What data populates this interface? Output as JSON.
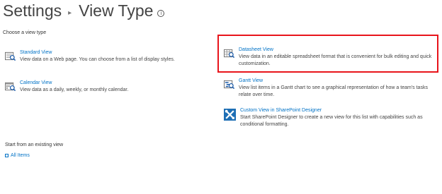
{
  "header": {
    "title_main": "Settings",
    "separator": "▸",
    "title_sub": "View Type",
    "info_glyph": "i"
  },
  "choose_label": "Choose a view type",
  "views": {
    "standard": {
      "name": "Standard View",
      "description": "View data on a Web page. You can choose from a list of display styles.",
      "icon": "standard-view-icon"
    },
    "calendar": {
      "name": "Calendar View",
      "description": "View data as a daily, weekly, or monthly calendar.",
      "icon": "calendar-view-icon"
    },
    "datasheet": {
      "name": "Datasheet View",
      "description": "View data in an editable spreadsheet format that is convenient for bulk editing and quick customization.",
      "icon": "datasheet-view-icon"
    },
    "gantt": {
      "name": "Gantt View",
      "description": "View list items in a Gantt chart to see a graphical representation of how a team's tasks relate over time.",
      "icon": "gantt-view-icon"
    },
    "custom": {
      "name": "Custom View in SharePoint Designer",
      "description": "Start SharePoint Designer to create a new view for this list with capabilities such as conditional formatting.",
      "icon": "sharepoint-designer-icon"
    }
  },
  "existing_label": "Start from an existing view",
  "existing_views": [
    "All Items"
  ],
  "colors": {
    "link": "#0072c6",
    "highlight_border": "#e8141b",
    "designer_tile": "#1e6fb5"
  }
}
